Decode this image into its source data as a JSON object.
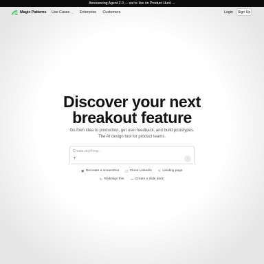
{
  "announcement": "Announcing Agent 2.0 — we're live on Product Hunt →",
  "nav": {
    "brand": "Magic Patterns",
    "links": [
      {
        "label": "Use Cases",
        "icon": "chevron-down-icon"
      },
      {
        "label": "Enterprise"
      },
      {
        "label": "Customers"
      }
    ],
    "login_label": "Login",
    "signup_label": "Sign Up"
  },
  "hero": {
    "title_line1": "Discover your next",
    "title_line2": "breakout feature",
    "subtitle_line1": "Go from idea to production, get user feedback, and build prototypes.",
    "subtitle_line2": "The AI design tool for product teams."
  },
  "prompt": {
    "placeholder": "Create anything...",
    "value": "",
    "plus_symbol": "+",
    "send_symbol": "↑"
  },
  "suggestions": [
    {
      "label": "Recreate a screenshot",
      "icon": "image-icon"
    },
    {
      "label": "Clone LinkedIn",
      "icon": "linkedin-icon"
    },
    {
      "label": "Landing page",
      "icon": "pencil-icon"
    },
    {
      "label": "Redesign this",
      "icon": "refresh-icon"
    },
    {
      "label": "Create a slide deck",
      "icon": "slides-icon"
    }
  ],
  "colors": {
    "announcement_bg": "#0b0b0b",
    "logo_green": "#4ebf6b",
    "page_bg": "#ffffff"
  }
}
